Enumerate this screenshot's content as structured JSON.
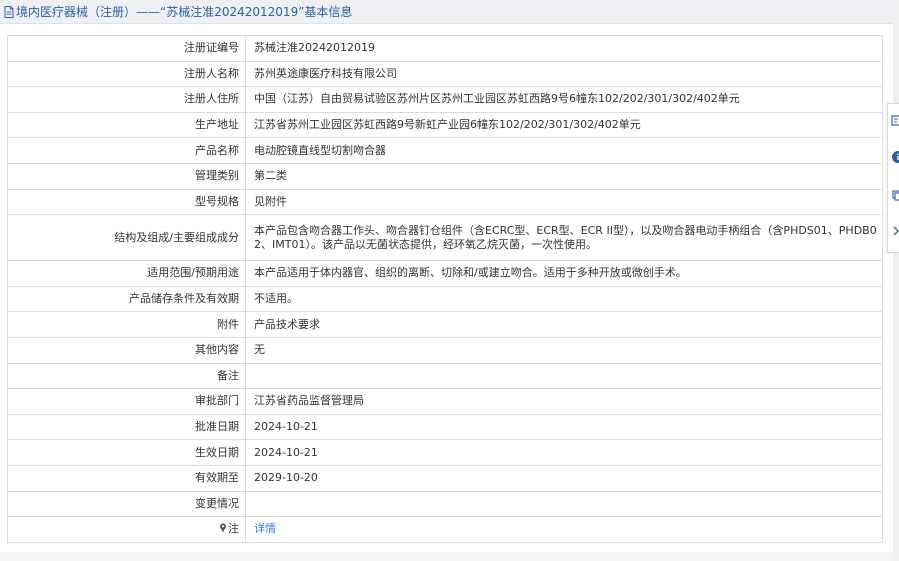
{
  "header": {
    "title": "境内医疗器械（注册）——“苏械注准20242012019”基本信息"
  },
  "rows": [
    {
      "label": "注册证编号",
      "value": "苏械注准20242012019"
    },
    {
      "label": "注册人名称",
      "value": "苏州英途康医疗科技有限公司"
    },
    {
      "label": "注册人住所",
      "value": "中国（江苏）自由贸易试验区苏州片区苏州工业园区苏虹西路9号6幢东102/202/301/302/402单元"
    },
    {
      "label": "生产地址",
      "value": "江苏省苏州工业园区苏虹西路9号新虹产业园6幢东102/202/301/302/402单元"
    },
    {
      "label": "产品名称",
      "value": "电动腔镜直线型切割吻合器"
    },
    {
      "label": "管理类别",
      "value": "第二类"
    },
    {
      "label": "型号规格",
      "value": "见附件"
    },
    {
      "label": "结构及组成/主要组成成分",
      "value": "本产品包含吻合器工作头、吻合器钉仓组件（含ECRC型、ECR型、ECR II型），以及吻合器电动手柄组合（含PHDS01、PHDB02、IMT01）。该产品以无菌状态提供，经环氧乙烷灭菌，一次性使用。"
    },
    {
      "label": "适用范围/预期用途",
      "value": "本产品适用于体内器官、组织的离断、切除和/或建立吻合。适用于多种开放或微创手术。"
    },
    {
      "label": "产品储存条件及有效期",
      "value": "不适用。"
    },
    {
      "label": "附件",
      "value": "产品技术要求"
    },
    {
      "label": "其他内容",
      "value": "无"
    },
    {
      "label": "备注",
      "value": ""
    },
    {
      "label": "审批部门",
      "value": "江苏省药品监督管理局"
    },
    {
      "label": "批准日期",
      "value": "2024-10-21"
    },
    {
      "label": "生效日期",
      "value": "2024-10-21"
    },
    {
      "label": "有效期至",
      "value": "2029-10-20"
    },
    {
      "label": "变更情况",
      "value": ""
    }
  ],
  "note_row": {
    "label": "注",
    "link_text": "详情"
  },
  "colors": {
    "title": "#2b5fa8",
    "link": "#2d7bd8",
    "border": "#dcdcdc"
  },
  "icons": {
    "title": "document-icon",
    "note": "pin-icon",
    "side_tools": [
      "feedback-icon",
      "info-circle-icon",
      "copy-icon",
      "chevron-right-icon"
    ]
  }
}
